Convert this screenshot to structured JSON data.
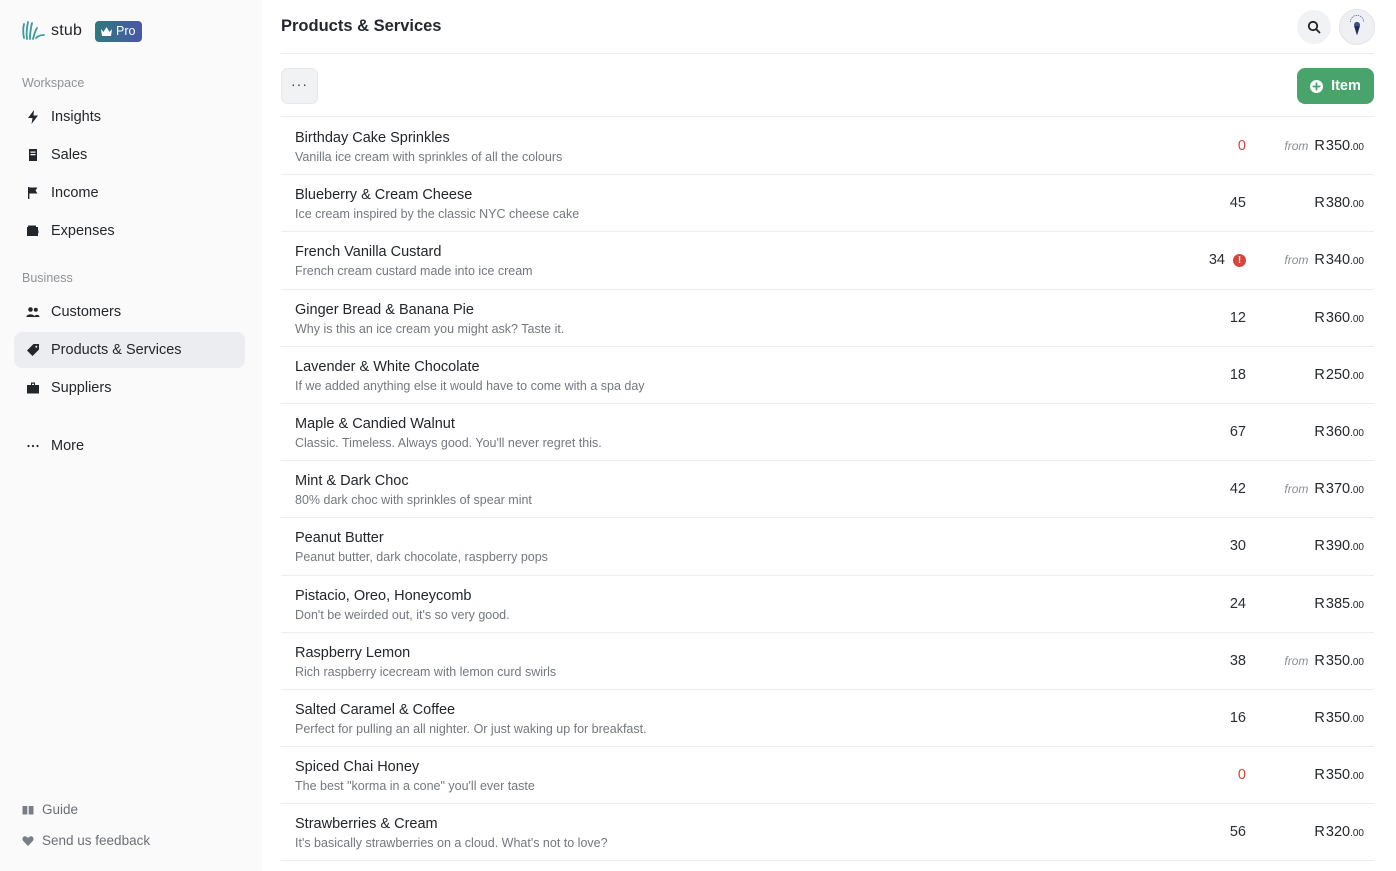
{
  "brand": {
    "name": "stub",
    "badge": "Pro"
  },
  "sidebar": {
    "workspace_label": "Workspace",
    "workspace": [
      {
        "label": "Insights",
        "icon": "bolt-icon"
      },
      {
        "label": "Sales",
        "icon": "receipt-icon"
      },
      {
        "label": "Income",
        "icon": "flag-icon"
      },
      {
        "label": "Expenses",
        "icon": "wallet-icon"
      }
    ],
    "business_label": "Business",
    "business": [
      {
        "label": "Customers",
        "icon": "users-icon"
      },
      {
        "label": "Products & Services",
        "icon": "tag-icon",
        "active": true
      },
      {
        "label": "Suppliers",
        "icon": "briefcase-icon"
      }
    ],
    "more": {
      "label": "More",
      "icon": "ellipsis-icon"
    },
    "footer": [
      {
        "label": "Guide",
        "icon": "book-icon"
      },
      {
        "label": "Send us feedback",
        "icon": "heart-icon"
      }
    ]
  },
  "header": {
    "title": "Products & Services"
  },
  "toolbar": {
    "more_label": "···",
    "add_label": "Item"
  },
  "colors": {
    "accent": "#48a46b",
    "danger": "#d6443b",
    "active_bg": "#ebedf0"
  },
  "items": [
    {
      "name": "Birthday Cake Sprinkles",
      "description": "Vanilla ice cream with sprinkles of all the colours",
      "qty": "0",
      "from": true,
      "currency": "R",
      "price": "350",
      "cents": ".00"
    },
    {
      "name": "Blueberry & Cream Cheese",
      "description": "Ice cream inspired by the classic NYC cheese cake",
      "qty": "45",
      "from": false,
      "currency": "R",
      "price": "380",
      "cents": ".00"
    },
    {
      "name": "French Vanilla Custard",
      "description": "French cream custard made into ice cream",
      "qty": "34",
      "warning": true,
      "from": true,
      "currency": "R",
      "price": "340",
      "cents": ".00"
    },
    {
      "name": "Ginger Bread & Banana Pie",
      "description": "Why is this an ice cream you might ask? Taste it.",
      "qty": "12",
      "from": false,
      "currency": "R",
      "price": "360",
      "cents": ".00"
    },
    {
      "name": "Lavender & White Chocolate",
      "description": "If we added anything else it would have to come with a spa day",
      "qty": "18",
      "from": false,
      "currency": "R",
      "price": "250",
      "cents": ".00"
    },
    {
      "name": "Maple & Candied Walnut",
      "description": "Classic. Timeless. Always good. You'll never regret this.",
      "qty": "67",
      "from": false,
      "currency": "R",
      "price": "360",
      "cents": ".00"
    },
    {
      "name": "Mint & Dark Choc",
      "description": "80% dark choc with sprinkles of spear mint",
      "qty": "42",
      "from": true,
      "currency": "R",
      "price": "370",
      "cents": ".00"
    },
    {
      "name": "Peanut Butter",
      "description": "Peanut butter, dark chocolate, raspberry pops",
      "qty": "30",
      "from": false,
      "currency": "R",
      "price": "390",
      "cents": ".00"
    },
    {
      "name": "Pistacio, Oreo, Honeycomb",
      "description": "Don't be weirded out, it's so very good.",
      "qty": "24",
      "from": false,
      "currency": "R",
      "price": "385",
      "cents": ".00"
    },
    {
      "name": "Raspberry Lemon",
      "description": "Rich raspberry icecream with lemon curd swirls",
      "qty": "38",
      "from": true,
      "currency": "R",
      "price": "350",
      "cents": ".00"
    },
    {
      "name": "Salted Caramel & Coffee",
      "description": "Perfect for pulling an all nighter. Or just waking up for breakfast.",
      "qty": "16",
      "from": false,
      "currency": "R",
      "price": "350",
      "cents": ".00"
    },
    {
      "name": "Spiced Chai Honey",
      "description": "The best \"korma in a cone\" you'll ever taste",
      "qty": "0",
      "from": false,
      "currency": "R",
      "price": "350",
      "cents": ".00"
    },
    {
      "name": "Strawberries & Cream",
      "description": "It's basically strawberries on a cloud. What's not to love?",
      "qty": "56",
      "from": false,
      "currency": "R",
      "price": "320",
      "cents": ".00"
    }
  ],
  "from_label": "from"
}
